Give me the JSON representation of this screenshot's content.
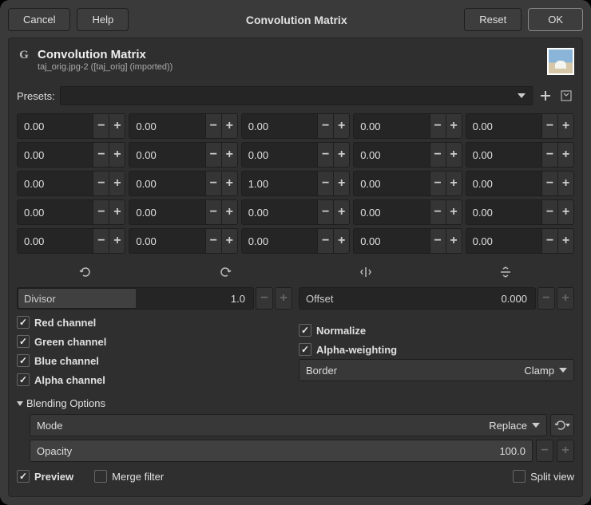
{
  "titlebar": {
    "cancel": "Cancel",
    "help": "Help",
    "title": "Convolution Matrix",
    "reset": "Reset",
    "ok": "OK"
  },
  "header": {
    "title": "Convolution Matrix",
    "subtitle": "taj_orig.jpg-2 ([taj_orig] (imported))"
  },
  "presets": {
    "label": "Presets:"
  },
  "matrix": [
    [
      "0.00",
      "0.00",
      "0.00",
      "0.00",
      "0.00"
    ],
    [
      "0.00",
      "0.00",
      "0.00",
      "0.00",
      "0.00"
    ],
    [
      "0.00",
      "0.00",
      "1.00",
      "0.00",
      "0.00"
    ],
    [
      "0.00",
      "0.00",
      "0.00",
      "0.00",
      "0.00"
    ],
    [
      "0.00",
      "0.00",
      "0.00",
      "0.00",
      "0.00"
    ]
  ],
  "divisor": {
    "label": "Divisor",
    "value": "1.0"
  },
  "offset": {
    "label": "Offset",
    "value": "0.000"
  },
  "channels": {
    "red": "Red channel",
    "green": "Green channel",
    "blue": "Blue channel",
    "alpha": "Alpha channel"
  },
  "options": {
    "normalize": "Normalize",
    "alpha_weight": "Alpha-weighting"
  },
  "border": {
    "label": "Border",
    "value": "Clamp"
  },
  "blending": {
    "header": "Blending Options",
    "mode_label": "Mode",
    "mode_value": "Replace",
    "opacity_label": "Opacity",
    "opacity_value": "100.0"
  },
  "footer": {
    "preview": "Preview",
    "merge": "Merge filter",
    "split": "Split view"
  }
}
